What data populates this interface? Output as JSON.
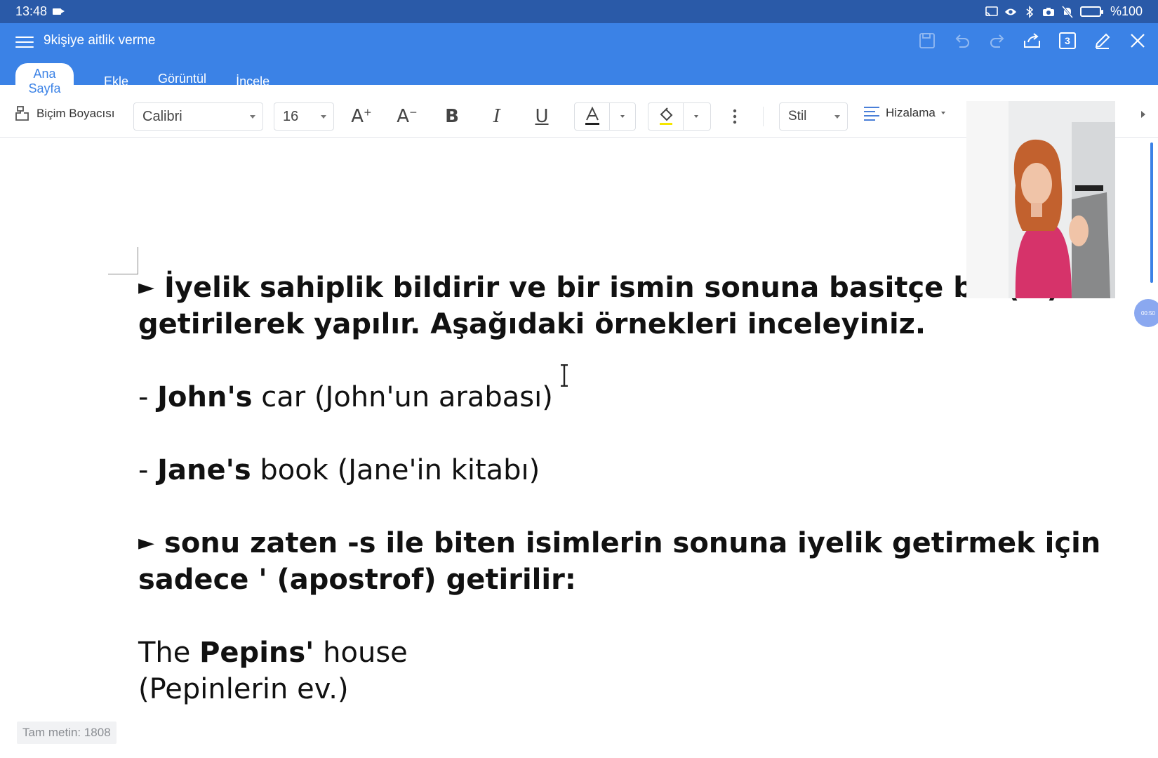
{
  "statusbar": {
    "time": "13:48",
    "battery": "%100"
  },
  "titlebar": {
    "title": "9kişiye aitlik verme",
    "tabs": [
      {
        "label": "Ana Sayfa"
      },
      {
        "label": "Ekle"
      },
      {
        "label": "Görüntül"
      },
      {
        "label": "İncele"
      }
    ],
    "page_count": "3"
  },
  "toolbar": {
    "format_painter": "Biçim Boyacısı",
    "font": "Calibri",
    "font_size": "16",
    "style": "Stil",
    "align": "Hizalama"
  },
  "document": {
    "para1_line1_text": "İyelik sahiplik bildirir ve bir ismin sonuna basitçe bir (‘s)",
    "para1_line2": "getirilerek yapılır. Aşağıdaki örnekleri inceleyiniz.",
    "ex1_dash": "- ",
    "ex1_bold": "John's",
    "ex1_rest": " car (John'un arabası)",
    "ex2_dash": "- ",
    "ex2_bold": "Jane's",
    "ex2_rest": " book (Jane'in kitabı)",
    "para2_line1_text": "sonu zaten -s ile biten isimlerin sonuna iyelik getirmek için",
    "para2_line2": "sadece ' (apostrof) getirilir:",
    "ex3_the": "The ",
    "ex3_bold": "Pepins'",
    "ex3_rest": " house",
    "ex3_translation": "(Pepinlerin ev.)",
    "bullet": "►"
  },
  "footer": {
    "word_count": "Tam metin: 1808"
  },
  "overlay": {
    "timer": "00:50"
  },
  "colors": {
    "statusbar": "#2a5aa8",
    "titlebar": "#3b82e6",
    "highlight": "#f5e600"
  }
}
